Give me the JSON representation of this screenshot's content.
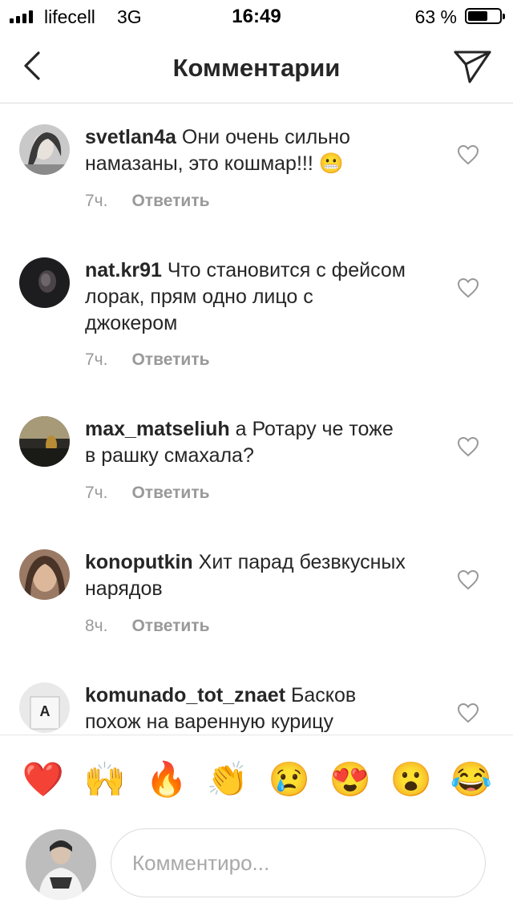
{
  "status_bar": {
    "carrier": "lifecell",
    "network": "3G",
    "time": "16:49",
    "battery_percent": "63 %",
    "battery_level": 0.63
  },
  "header": {
    "title": "Комментарии",
    "back_icon": "chevron-left-icon",
    "send_icon": "paper-plane-icon"
  },
  "comments": [
    {
      "username": "svetlan4a",
      "text": "Они очень сильно намазаны,  это кошмар!!! 😬",
      "time": "7ч.",
      "reply": "Ответить"
    },
    {
      "username": "nat.kr91",
      "text": "Что становится с фейсом лорак, прям одно лицо с джокером",
      "time": "7ч.",
      "reply": "Ответить"
    },
    {
      "username": "max_matseliuh",
      "text": "а Ротару че тоже в рашку смахала?",
      "time": "7ч.",
      "reply": "Ответить"
    },
    {
      "username": "konoputkin",
      "text": "Хит парад безвкусных нарядов",
      "time": "8ч.",
      "reply": "Ответить"
    },
    {
      "username": "komunado_tot_znaet",
      "text": "Басков похож на варенную курицу",
      "time": "",
      "reply": ""
    }
  ],
  "emoji_bar": [
    "❤️",
    "🙌",
    "🔥",
    "👏",
    "😢",
    "😍",
    "😮",
    "😂"
  ],
  "composer": {
    "placeholder": "Комментиро..."
  },
  "colors": {
    "text": "#262626",
    "meta": "#999999",
    "divider": "#dbdbdb",
    "background": "#ffffff"
  }
}
